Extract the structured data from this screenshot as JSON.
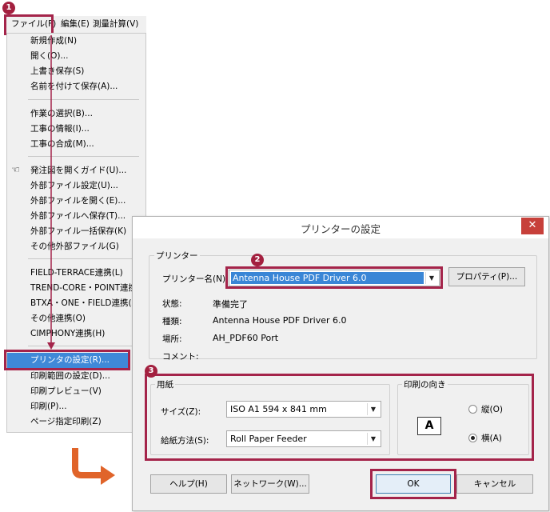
{
  "markers": {
    "m1": "1",
    "m2": "2",
    "m3": "3"
  },
  "menubar": {
    "file": "ファイル(F)",
    "edit": "編集(E)",
    "survey": "測量計算(V)"
  },
  "menu": {
    "items": [
      "新規作成(N)",
      "開く(O)...",
      "上書き保存(S)",
      "名前を付けて保存(A)...",
      "作業の選択(B)...",
      "工事の情報(I)...",
      "工事の合成(M)...",
      "発注図を開くガイド(U)...",
      "外部ファイル設定(U)...",
      "外部ファイルを開く(E)...",
      "外部ファイルへ保存(T)...",
      "外部ファイル一括保存(K)",
      "その他外部ファイル(G)",
      "FIELD-TERRACE連携(L)",
      "TREND-CORE・POINT連携(Q)",
      "BTXA・ONE・FIELD連携(X)",
      "その他連携(O)",
      "CIMPHONY連携(H)",
      "プリンタの設定(R)...",
      "印刷範囲の設定(D)...",
      "印刷プレビュー(V)",
      "印刷(P)...",
      "ページ指定印刷(Z)"
    ]
  },
  "dialog": {
    "title": "プリンターの設定",
    "close": "✕",
    "printer_group": "プリンター",
    "printer_name_label": "プリンター名(N):",
    "printer_name_value": "Antenna House PDF Driver 6.0",
    "properties_button": "プロパティ(P)...",
    "status_label": "状態:",
    "status_value": "準備完了",
    "type_label": "種類:",
    "type_value": "Antenna House PDF Driver 6.0",
    "location_label": "場所:",
    "location_value": "AH_PDF60 Port",
    "comment_label": "コメント:",
    "paper_group": "用紙",
    "size_label": "サイズ(Z):",
    "size_value": "ISO A1 594 x 841 mm",
    "source_label": "給紙方法(S):",
    "source_value": "Roll Paper Feeder",
    "orientation_group": "印刷の向き",
    "portrait_label": "縦(O)",
    "landscape_label": "横(A)",
    "orientation_selected": "landscape",
    "help_button": "ヘルプ(H)",
    "network_button": "ネットワーク(W)...",
    "ok_button": "OK",
    "cancel_button": "キャンセル"
  },
  "colors": {
    "accent": "#a4244a",
    "selection": "#3f89d8",
    "close": "#c7403a",
    "flow_arrow": "#e0642a"
  }
}
